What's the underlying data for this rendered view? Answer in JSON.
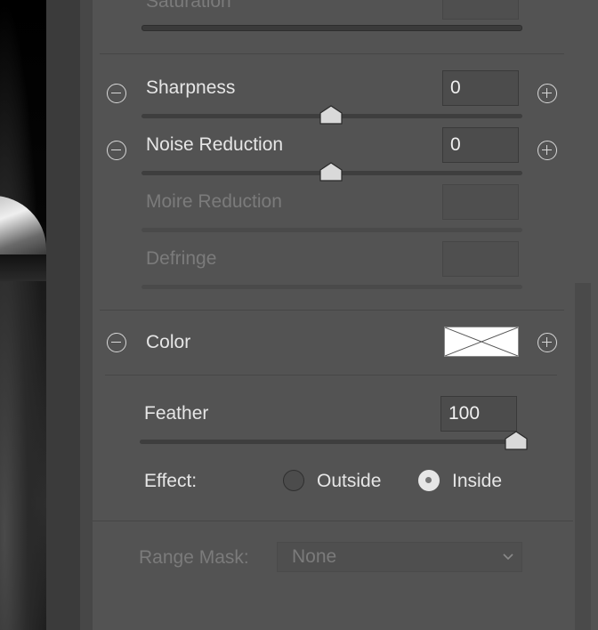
{
  "saturation": {
    "label": "Saturation"
  },
  "sharpness": {
    "label": "Sharpness",
    "value": "0",
    "slider_level": 0.5
  },
  "noise_reduction": {
    "label": "Noise Reduction",
    "value": "0",
    "slider_level": 0.5
  },
  "moire_reduction": {
    "label": "Moire Reduction",
    "value": ""
  },
  "defringe": {
    "label": "Defringe",
    "value": ""
  },
  "color": {
    "label": "Color",
    "swatch": "none"
  },
  "feather": {
    "label": "Feather",
    "value": "100",
    "slider_level": 1.0
  },
  "effect": {
    "label": "Effect:",
    "options": [
      {
        "label": "Outside",
        "selected": false
      },
      {
        "label": "Inside",
        "selected": true
      }
    ]
  },
  "range_mask": {
    "label": "Range Mask:",
    "value": "None"
  },
  "icons": [
    "minus-circle-icon",
    "plus-circle-icon",
    "slider-thumb-icon",
    "chevron-down-icon",
    "no-color-swatch-icon"
  ],
  "colors": {
    "panel_bg": "#535353",
    "text": "#e6e6e6",
    "disabled_text": "#7b7b7b"
  }
}
